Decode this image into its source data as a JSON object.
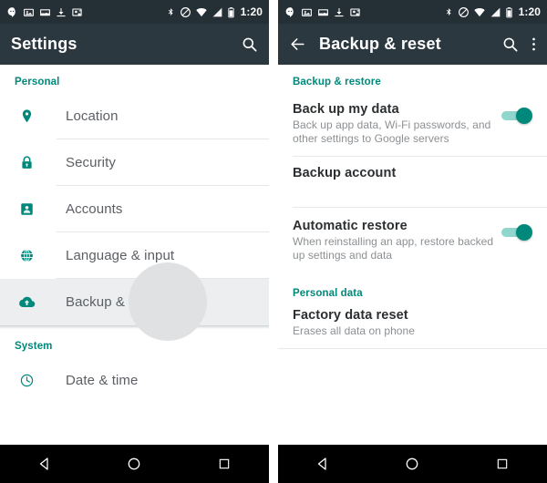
{
  "status_bar": {
    "notification_icons": [
      "hangouts-icon",
      "photos-icon",
      "image-icon",
      "download-icon",
      "screenshot-icon"
    ],
    "system_icons": [
      "bluetooth-icon",
      "do-not-disturb-icon",
      "wifi-icon",
      "cell-signal-icon",
      "battery-icon"
    ],
    "time": "1:20"
  },
  "left_panel": {
    "appbar": {
      "title": "Settings",
      "search_icon": "search-icon"
    },
    "sections": [
      {
        "header": "Personal",
        "items": [
          {
            "label": "Location",
            "icon": "location-pin-icon",
            "pressed": false
          },
          {
            "label": "Security",
            "icon": "lock-icon",
            "pressed": false
          },
          {
            "label": "Accounts",
            "icon": "account-badge-icon",
            "pressed": false
          },
          {
            "label": "Language & input",
            "icon": "globe-icon",
            "pressed": false
          },
          {
            "label": "Backup & reset",
            "icon": "cloud-upload-icon",
            "pressed": true
          }
        ]
      },
      {
        "header": "System",
        "items": [
          {
            "label": "Date & time",
            "icon": "clock-icon",
            "pressed": false
          }
        ]
      }
    ]
  },
  "right_panel": {
    "appbar": {
      "back_icon": "arrow-back-icon",
      "title": "Backup & reset",
      "search_icon": "search-icon",
      "overflow_icon": "more-vert-icon"
    },
    "sections": [
      {
        "header": "Backup & restore",
        "items": [
          {
            "title": "Back up my data",
            "subtitle": "Back up app data, Wi-Fi passwords, and other settings to Google servers",
            "has_switch": true,
            "switch_on": true
          },
          {
            "title": "Backup account",
            "subtitle": "",
            "has_switch": false,
            "switch_on": false
          },
          {
            "title": "Automatic restore",
            "subtitle": "When reinstalling an app, restore backed up settings and data",
            "has_switch": true,
            "switch_on": true
          }
        ]
      },
      {
        "header": "Personal data",
        "items": [
          {
            "title": "Factory data reset",
            "subtitle": "Erases all data on phone",
            "has_switch": false,
            "switch_on": false
          }
        ]
      }
    ]
  },
  "nav_bar": {
    "back_icon": "nav-back-triangle-icon",
    "home_icon": "nav-home-circle-icon",
    "recents_icon": "nav-recents-square-icon"
  },
  "colors": {
    "accent_teal": "#00897b",
    "appbar": "#2b3840",
    "statusbar": "#252f36",
    "navbar": "#000000",
    "title_text": "#2c2f31",
    "subtitle_text": "#8c9093",
    "list_label": "#5b5f63"
  }
}
